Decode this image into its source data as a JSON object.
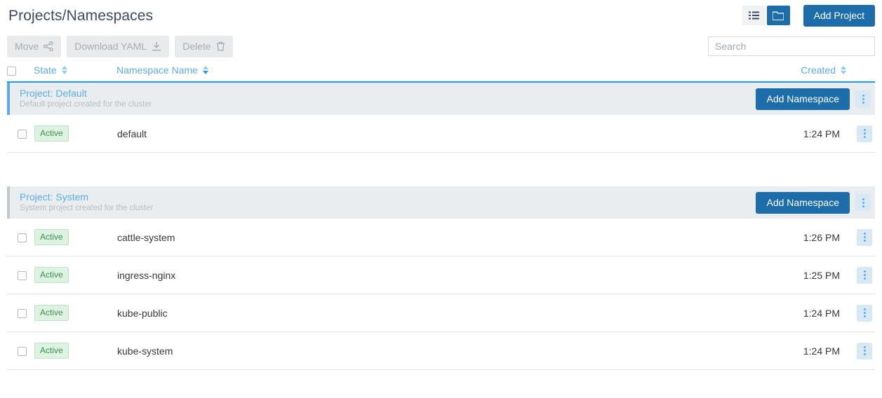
{
  "header": {
    "title": "Projects/Namespaces",
    "view_toggle": [
      {
        "name": "list-view",
        "icon": "list-icon",
        "active": false
      },
      {
        "name": "folder-view",
        "icon": "folder-icon",
        "active": true
      }
    ],
    "add_project_label": "Add Project"
  },
  "toolbar": {
    "move_label": "Move",
    "move_icon": "share-icon",
    "download_label": "Download YAML",
    "download_icon": "download-icon",
    "delete_label": "Delete",
    "delete_icon": "trash-icon",
    "search_placeholder": "Search",
    "search_value": ""
  },
  "table": {
    "columns": {
      "state": "State",
      "name": "Namespace Name",
      "created": "Created"
    },
    "sort": {
      "active_column": "Namespace Name",
      "direction": "desc"
    },
    "groups": [
      {
        "title": "Project: Default",
        "subtitle": "Default project created for the cluster",
        "accent": "#5badea",
        "add_label": "Add Namespace",
        "rows": [
          {
            "state": "Active",
            "name": "default",
            "created": "1:24 PM"
          }
        ]
      },
      {
        "title": "Project: System",
        "subtitle": "System project created for the cluster",
        "accent": "#c3c8cc",
        "add_label": "Add Namespace",
        "rows": [
          {
            "state": "Active",
            "name": "cattle-system",
            "created": "1:26 PM"
          },
          {
            "state": "Active",
            "name": "ingress-nginx",
            "created": "1:25 PM"
          },
          {
            "state": "Active",
            "name": "kube-public",
            "created": "1:24 PM"
          },
          {
            "state": "Active",
            "name": "kube-system",
            "created": "1:24 PM"
          }
        ]
      }
    ]
  },
  "colors": {
    "primary": "#1c6daa",
    "link": "#5badea",
    "header_underline": "#2398e8",
    "group_bg": "#e9edef",
    "badge_bg": "#ddf2e1",
    "badge_text": "#3d9153"
  }
}
